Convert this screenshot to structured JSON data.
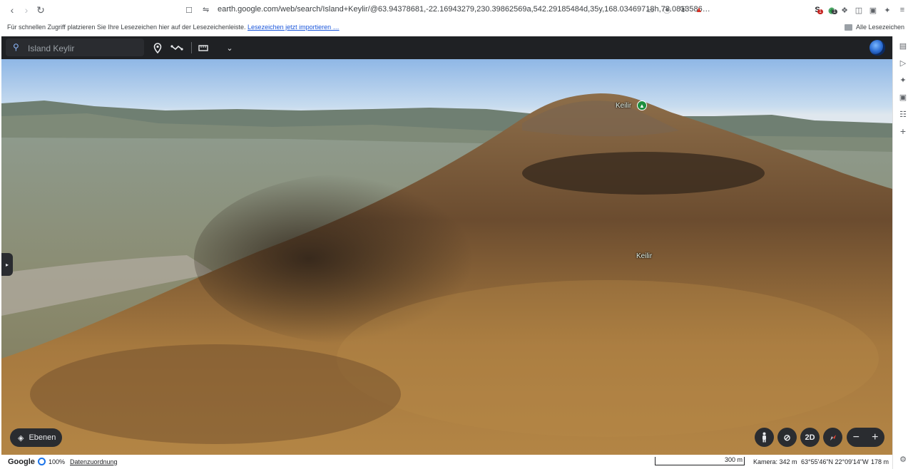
{
  "browser": {
    "url": "earth.google.com/web/search/Island+Keylir/@63.94378681,-22.16943279,230.39862569a,542.29185484d,35y,168.03469718h,78.0813586…",
    "bookmarks_hint": "Für schnellen Zugriff platzieren Sie Ihre Lesezeichen hier auf der Lesezeichenleiste.",
    "bookmarks_import_link": "Lesezeichen jetzt importieren …",
    "all_bookmarks": "Alle Lesezeichen",
    "badge_count_1": "1",
    "badge_count_2": "1"
  },
  "earth": {
    "search_placeholder": "Island Keylir",
    "peak_label": "Keilir",
    "slope_label": "Keilir",
    "layers_button": "Ebenen",
    "view_mode_button": "2D"
  },
  "status": {
    "logo": "Google",
    "zoom": "100%",
    "attribution": "Datenzuordnung",
    "scale_label": "300 m",
    "camera": "Kamera: 342 m",
    "coordinates": "63°55'46\"N 22°09'14\"W",
    "altitude": "178 m"
  },
  "colors": {
    "accent": "#1a73e8",
    "pin_green": "#1e8e3e",
    "toolbar_dark": "#1f2124"
  }
}
